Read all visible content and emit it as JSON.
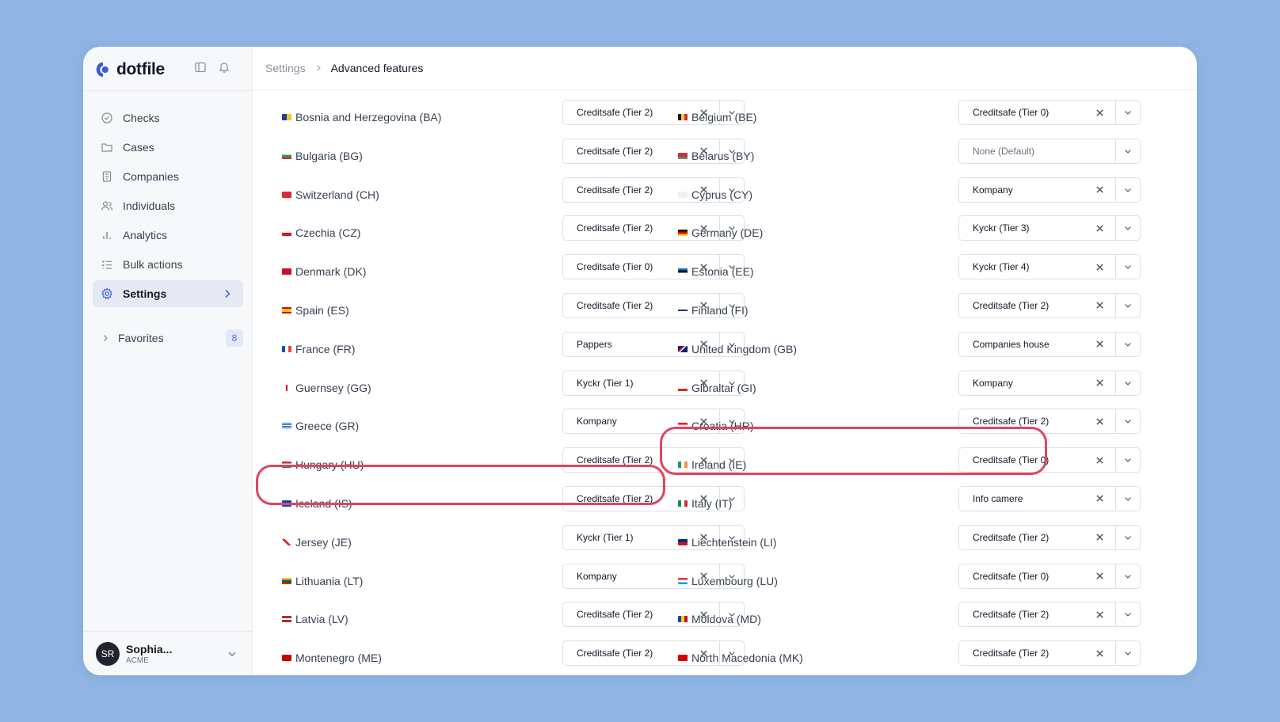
{
  "app": {
    "name": "dotfile"
  },
  "sidebar": {
    "items": [
      {
        "label": "Checks",
        "icon": "check-circle-icon"
      },
      {
        "label": "Cases",
        "icon": "folder-icon"
      },
      {
        "label": "Companies",
        "icon": "building-icon"
      },
      {
        "label": "Individuals",
        "icon": "users-icon"
      },
      {
        "label": "Analytics",
        "icon": "bar-chart-icon"
      },
      {
        "label": "Bulk actions",
        "icon": "list-check-icon"
      },
      {
        "label": "Settings",
        "icon": "gear-icon",
        "active": true
      }
    ],
    "favorites": {
      "label": "Favorites",
      "count": "8"
    },
    "user": {
      "initials": "SR",
      "name": "Sophia...",
      "org": "ACME"
    }
  },
  "breadcrumb": {
    "parent": "Settings",
    "current": "Advanced features"
  },
  "colors": {
    "accent": "#4f6bd8",
    "highlight": "#e24462",
    "background": "#8fb4e3"
  },
  "rows": [
    {
      "left": {
        "country": "Bosnia and Herzegovina (BA)",
        "value": "Creditsafe (Tier 2)"
      },
      "right": {
        "country": "Belgium (BE)",
        "value": "Creditsafe (Tier 0)"
      }
    },
    {
      "left": {
        "country": "Bulgaria (BG)",
        "value": "Creditsafe (Tier 2)"
      },
      "right": {
        "country": "Belarus (BY)",
        "value": "",
        "placeholder": "None (Default)"
      }
    },
    {
      "left": {
        "country": "Switzerland (CH)",
        "value": "Creditsafe (Tier 2)"
      },
      "right": {
        "country": "Cyprus (CY)",
        "value": "Kompany"
      }
    },
    {
      "left": {
        "country": "Czechia (CZ)",
        "value": "Creditsafe (Tier 2)"
      },
      "right": {
        "country": "Germany (DE)",
        "value": "Kyckr (Tier 3)"
      }
    },
    {
      "left": {
        "country": "Denmark (DK)",
        "value": "Creditsafe (Tier 0)"
      },
      "right": {
        "country": "Estonia (EE)",
        "value": "Kyckr (Tier 4)"
      }
    },
    {
      "left": {
        "country": "Spain (ES)",
        "value": "Creditsafe (Tier 2)"
      },
      "right": {
        "country": "Finland (FI)",
        "value": "Creditsafe (Tier 2)"
      }
    },
    {
      "left": {
        "country": "France (FR)",
        "value": "Pappers"
      },
      "right": {
        "country": "United Kingdom (GB)",
        "value": "Companies house"
      }
    },
    {
      "left": {
        "country": "Guernsey (GG)",
        "value": "Kyckr (Tier 1)"
      },
      "right": {
        "country": "Gibraltar (GI)",
        "value": "Kompany"
      }
    },
    {
      "left": {
        "country": "Greece (GR)",
        "value": "Kompany"
      },
      "right": {
        "country": "Croatia (HR)",
        "value": "Creditsafe (Tier 2)"
      }
    },
    {
      "left": {
        "country": "Hungary (HU)",
        "value": "Creditsafe (Tier 2)"
      },
      "right": {
        "country": "Ireland (IE)",
        "value": "Creditsafe (Tier 0)"
      }
    },
    {
      "left": {
        "country": "Iceland (IS)",
        "value": "Creditsafe (Tier 2)"
      },
      "right": {
        "country": "Italy (IT)",
        "value": "Info camere"
      }
    },
    {
      "left": {
        "country": "Jersey (JE)",
        "value": "Kyckr (Tier 1)"
      },
      "right": {
        "country": "Liechtenstein (LI)",
        "value": "Creditsafe (Tier 2)"
      }
    },
    {
      "left": {
        "country": "Lithuania (LT)",
        "value": "Kompany"
      },
      "right": {
        "country": "Luxembourg (LU)",
        "value": "Creditsafe (Tier 0)"
      }
    },
    {
      "left": {
        "country": "Latvia (LV)",
        "value": "Creditsafe (Tier 2)"
      },
      "right": {
        "country": "Moldova (MD)",
        "value": "Creditsafe (Tier 2)"
      }
    },
    {
      "left": {
        "country": "Montenegro (ME)",
        "value": "Creditsafe (Tier 2)"
      },
      "right": {
        "country": "North Macedonia (MK)",
        "value": "Creditsafe (Tier 2)"
      }
    }
  ]
}
